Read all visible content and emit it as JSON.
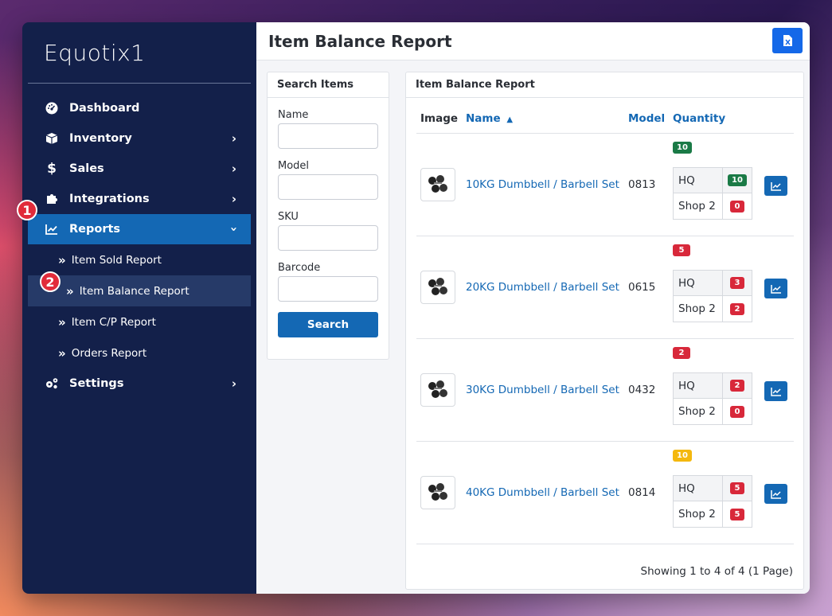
{
  "app": {
    "logo_text": "Equotix1"
  },
  "sidebar": {
    "items": [
      {
        "label": "Dashboard",
        "icon": "dashboard-gauge-icon"
      },
      {
        "label": "Inventory",
        "icon": "box-icon"
      },
      {
        "label": "Sales",
        "icon": "dollar-icon"
      },
      {
        "label": "Integrations",
        "icon": "puzzle-icon"
      },
      {
        "label": "Reports",
        "icon": "line-chart-icon"
      },
      {
        "label": "Settings",
        "icon": "gears-icon"
      }
    ],
    "reports_sub": [
      {
        "label": "Item Sold Report"
      },
      {
        "label": "Item Balance Report"
      },
      {
        "label": "Item C/P Report"
      },
      {
        "label": "Orders Report"
      }
    ],
    "step_badges": [
      "1",
      "2"
    ]
  },
  "header": {
    "title": "Item Balance Report",
    "export_icon": "excel-file-icon"
  },
  "search": {
    "title": "Search Items",
    "fields": [
      {
        "label": "Name",
        "value": ""
      },
      {
        "label": "Model",
        "value": ""
      },
      {
        "label": "SKU",
        "value": ""
      },
      {
        "label": "Barcode",
        "value": ""
      }
    ],
    "button_label": "Search"
  },
  "report": {
    "title": "Item Balance Report",
    "columns": {
      "image": "Image",
      "name": "Name",
      "model": "Model",
      "quantity": "Quantity"
    },
    "rows": [
      {
        "name": "10KG Dumbbell / Barbell Set",
        "model": "0813",
        "total": "10",
        "total_color": "#1a7a46",
        "locations": [
          {
            "loc": "HQ",
            "qty": "10",
            "color": "#1a7a46"
          },
          {
            "loc": "Shop 2",
            "qty": "0",
            "color": "#d8283a"
          }
        ]
      },
      {
        "name": "20KG Dumbbell / Barbell Set",
        "model": "0615",
        "total": "5",
        "total_color": "#d8283a",
        "locations": [
          {
            "loc": "HQ",
            "qty": "3",
            "color": "#d8283a"
          },
          {
            "loc": "Shop 2",
            "qty": "2",
            "color": "#d8283a"
          }
        ]
      },
      {
        "name": "30KG Dumbbell / Barbell Set",
        "model": "0432",
        "total": "2",
        "total_color": "#d8283a",
        "locations": [
          {
            "loc": "HQ",
            "qty": "2",
            "color": "#d8283a"
          },
          {
            "loc": "Shop 2",
            "qty": "0",
            "color": "#d8283a"
          }
        ]
      },
      {
        "name": "40KG Dumbbell / Barbell Set",
        "model": "0814",
        "total": "10",
        "total_color": "#f4b80e",
        "locations": [
          {
            "loc": "HQ",
            "qty": "5",
            "color": "#d8283a"
          },
          {
            "loc": "Shop 2",
            "qty": "5",
            "color": "#d8283a"
          }
        ]
      }
    ],
    "pager_text": "Showing 1 to 4 of 4 (1 Page)"
  }
}
